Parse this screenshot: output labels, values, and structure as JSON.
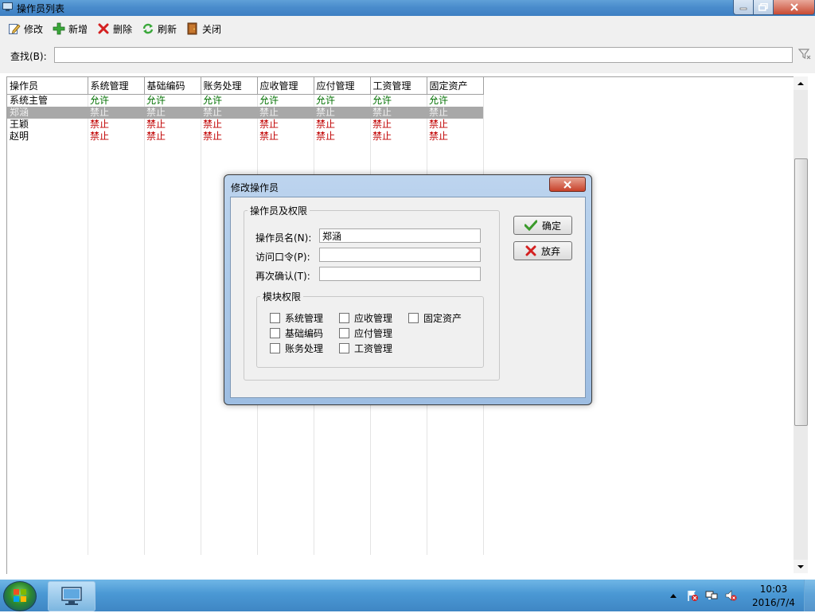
{
  "window": {
    "title": "操作员列表"
  },
  "toolbar": {
    "edit": "修改",
    "add": "新增",
    "delete": "删除",
    "refresh": "刷新",
    "close": "关闭"
  },
  "search": {
    "label": "查找(B):",
    "value": ""
  },
  "grid": {
    "columns": [
      "操作员",
      "系统管理",
      "基础编码",
      "账务处理",
      "应收管理",
      "应付管理",
      "工资管理",
      "固定资产"
    ],
    "rows": [
      {
        "name": "系统主管",
        "perms": [
          "允许",
          "允许",
          "允许",
          "允许",
          "允许",
          "允许",
          "允许"
        ],
        "selected": false
      },
      {
        "name": "郑涵",
        "perms": [
          "禁止",
          "禁止",
          "禁止",
          "禁止",
          "禁止",
          "禁止",
          "禁止"
        ],
        "selected": true
      },
      {
        "name": "王颖",
        "perms": [
          "禁止",
          "禁止",
          "禁止",
          "禁止",
          "禁止",
          "禁止",
          "禁止"
        ],
        "selected": false
      },
      {
        "name": "赵明",
        "perms": [
          "禁止",
          "禁止",
          "禁止",
          "禁止",
          "禁止",
          "禁止",
          "禁止"
        ],
        "selected": false
      }
    ]
  },
  "dialog": {
    "title": "修改操作员",
    "group_title": "操作员及权限",
    "operator_label": "操作员名(N):",
    "operator_value": "郑涵",
    "password_label": "访问口令(P):",
    "password_value": "",
    "confirm_label": "再次确认(T):",
    "confirm_value": "",
    "modules_title": "模块权限",
    "modules": [
      {
        "label": "系统管理",
        "checked": false
      },
      {
        "label": "应收管理",
        "checked": false
      },
      {
        "label": "固定资产",
        "checked": false
      },
      {
        "label": "基础编码",
        "checked": false
      },
      {
        "label": "应付管理",
        "checked": false
      },
      {
        "label": "账务处理",
        "checked": false
      },
      {
        "label": "工资管理",
        "checked": false
      }
    ],
    "ok_label": "确定",
    "cancel_label": "放弃"
  },
  "taskbar": {
    "time": "10:03",
    "date": "2016/7/4"
  },
  "colors": {
    "allow": "#007000",
    "deny": "#c00000",
    "selected_row": "#a8a8a8"
  }
}
